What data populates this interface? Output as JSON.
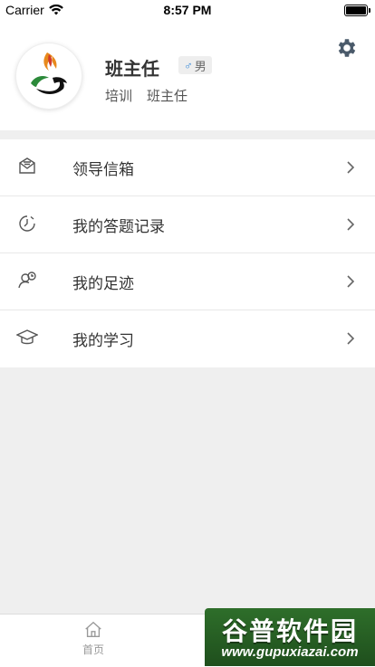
{
  "status_bar": {
    "carrier": "Carrier",
    "time": "8:57 PM"
  },
  "profile": {
    "name": "班主任",
    "gender_symbol": "♂",
    "gender": "男",
    "org": "培训",
    "role": "班主任"
  },
  "menu": [
    {
      "label": "领导信箱",
      "icon": "mailbox-icon"
    },
    {
      "label": "我的答题记录",
      "icon": "clock-icon"
    },
    {
      "label": "我的足迹",
      "icon": "user-history-icon"
    },
    {
      "label": "我的学习",
      "icon": "graduation-cap-icon"
    }
  ],
  "tabbar": {
    "home_label": "首页"
  },
  "watermark": {
    "title": "谷普软件园",
    "url": "www.gupuxiazai.com"
  },
  "colors": {
    "accent": "#4a5a6a",
    "background": "#efefef",
    "watermark_green": "#2e6e2a"
  }
}
